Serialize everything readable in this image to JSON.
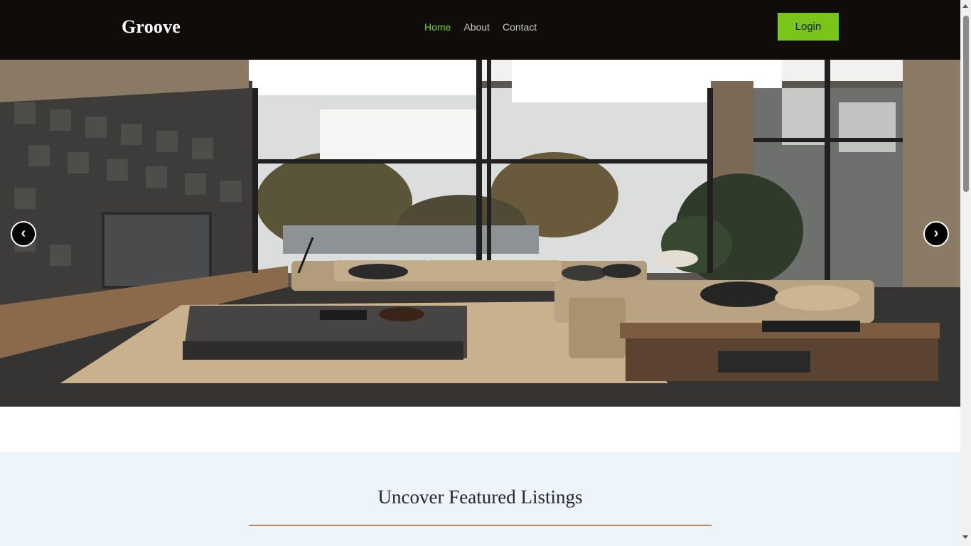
{
  "header": {
    "brand": "Groove",
    "nav": [
      {
        "label": "Home",
        "active": true
      },
      {
        "label": "About",
        "active": false
      },
      {
        "label": "Contact",
        "active": false
      }
    ],
    "login_label": "Login"
  },
  "hero": {
    "prev_label": "‹",
    "next_label": "›"
  },
  "featured": {
    "title": "Uncover Featured Listings"
  },
  "colors": {
    "header_bg": "#0f0c09",
    "accent": "#79c51a",
    "nav_active": "#7ecf1c",
    "section_bg": "#eef4fc",
    "rule": "#b98b5c"
  }
}
